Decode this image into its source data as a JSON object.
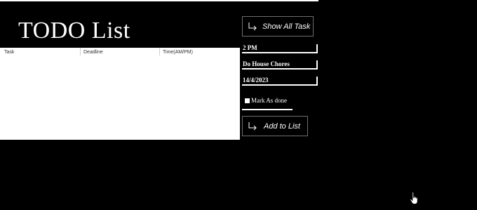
{
  "app": {
    "title": "TODO List"
  },
  "table": {
    "columns": [
      "Task",
      "Deadline",
      "Time(AM/PM)"
    ],
    "rows": []
  },
  "buttons": {
    "show_all": "Show All Task",
    "add": "Add to List"
  },
  "form": {
    "time_value": "2 PM",
    "task_value": "Do House Chores",
    "date_value": "14/4/2023",
    "mark_done_label": "Mark As done",
    "mark_done_checked": false
  },
  "icons": {
    "button_arrow": "turn-right-arrow-icon",
    "cursor": "hand-pointer-icon"
  },
  "colors": {
    "background": "#000000",
    "text": "#ffffff",
    "table_background": "#ffffff",
    "button_border": "#6e6e6e"
  }
}
